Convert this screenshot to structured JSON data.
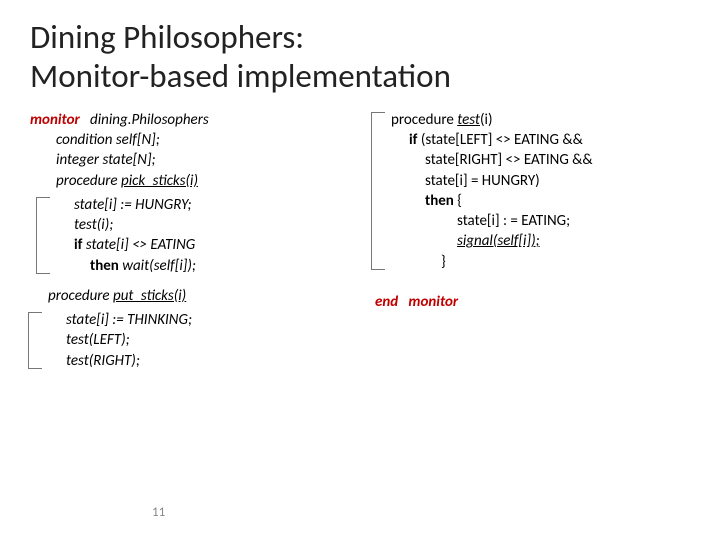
{
  "title_line1": "Dining Philosophers:",
  "title_line2": "Monitor-based implementation",
  "left": {
    "l1a": "monitor",
    "l1b": "dining.Philosophers",
    "l2": "condition self[N];",
    "l3": "integer state[N];",
    "l4a": "procedure ",
    "l4b": "pick_sticks(i)",
    "l5": "state[i] := HUNGRY;",
    "l6": "test(i);",
    "l7a": "if  ",
    "l7b": "state[i] <> EATING",
    "l8a": "then ",
    "l8b": "wait(self[i]);",
    "p1a": "procedure ",
    "p1b": "put_sticks(i)",
    "p2": "state[i] := THINKING;",
    "p3": "test(LEFT);",
    "p4": "test(RIGHT);"
  },
  "right": {
    "r1a": "procedure ",
    "r1b": "test",
    "r1c": "(i)",
    "r2a": "if  ",
    "r2b": "(state[LEFT] <> EATING  &&",
    "r3": "state[RIGHT] <> EATING &&",
    "r4": "state[i] = HUNGRY)",
    "r5a": "then",
    "r5b": " {",
    "r6": "state[i] : = EATING;",
    "r7": "signal(self[i]);",
    "r8": "}",
    "end_a": "end",
    "end_b": "monitor"
  },
  "pagenum": "11"
}
